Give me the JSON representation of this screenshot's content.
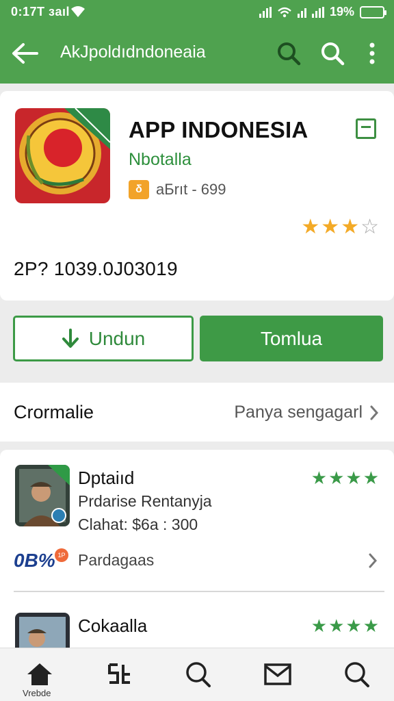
{
  "status_bar": {
    "time": "0:17T зaıl",
    "battery": "19%"
  },
  "app_bar": {
    "title": "AkJpoldıdndoneaia",
    "icons": [
      "back-arrow-icon",
      "search-icon",
      "search-icon",
      "more-vert-icon"
    ]
  },
  "app": {
    "name": "APP INDONESIA",
    "developer": "Nbotalla",
    "age_badge": "δ",
    "meta": "aБrıt - 699",
    "rating": 3,
    "rating_max": 4,
    "price_line": "2P? 1039.0J03019"
  },
  "actions": {
    "download": "Undun",
    "open": "Tomlua"
  },
  "section": {
    "title": "Crormalie",
    "link": "Panya sengagarl"
  },
  "list": {
    "items": [
      {
        "title": "Dptaiıd",
        "subtitle": "Prdarise Rentanyja",
        "detail": "Clahat: $6a : 300",
        "stars": 4
      },
      {
        "title": "Cokaalla",
        "stars": 4
      }
    ],
    "promo": {
      "logo": "0B%",
      "badge": "1P",
      "label": "Pardagaas"
    }
  },
  "bottom_nav": {
    "items": [
      "home-icon",
      "apps-icon",
      "search-icon",
      "mail-icon",
      "search-icon"
    ],
    "home_label": "Vrebde"
  },
  "colors": {
    "primary": "#4fa24f",
    "accent_star": "#f3aa27",
    "list_star": "#3a9a48"
  }
}
